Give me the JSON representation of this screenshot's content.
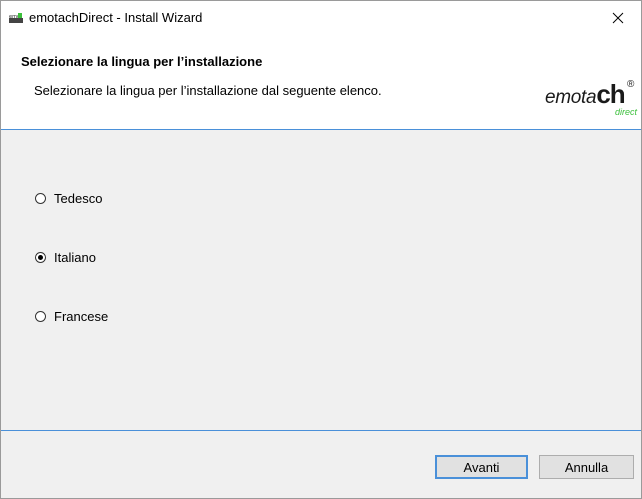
{
  "window": {
    "title": "emotachDirect - Install Wizard"
  },
  "header": {
    "title": "Selezionare la lingua per l’installazione",
    "subtitle": "Selezionare la lingua per l’installazione dal seguente elenco."
  },
  "logo": {
    "word": "emota",
    "word_bold": "ch",
    "registered": "®",
    "sub": "direct",
    "accent_color": "#3bbf3b"
  },
  "languages": [
    {
      "label": "Tedesco",
      "selected": false
    },
    {
      "label": "Italiano",
      "selected": true
    },
    {
      "label": "Francese",
      "selected": false
    }
  ],
  "buttons": {
    "next_label": "Avanti",
    "cancel_label": "Annulla"
  },
  "colors": {
    "separator": "#4a90d9",
    "panel_bg": "#f0f0f0"
  },
  "icons": {
    "app": "emotach-app-icon",
    "close": "close-icon"
  }
}
